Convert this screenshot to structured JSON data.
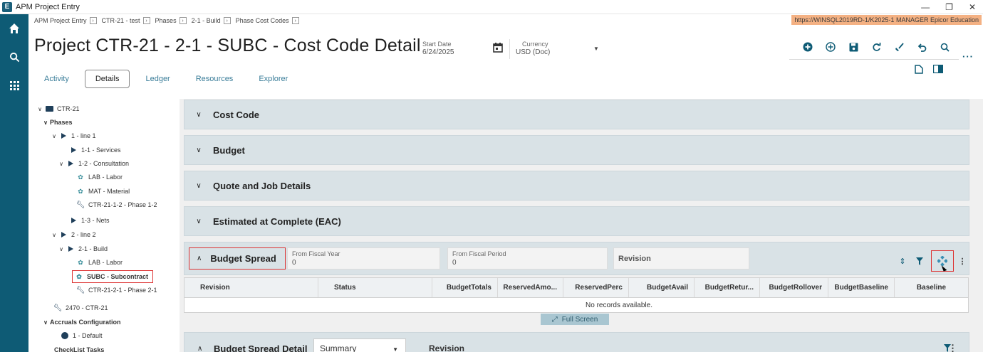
{
  "window": {
    "title": "APM Project Entry"
  },
  "breadcrumbs": [
    "APM Project Entry",
    "CTR-21 - test",
    "Phases",
    "2-1 - Build",
    "Phase Cost Codes"
  ],
  "server_info": "https://WINSQL2019RD-1/K2025-1  MANAGER  Epicor Education",
  "header": {
    "title": "Project CTR-21 - 2-1 - SUBC - Cost Code Detail",
    "start_date_label": "Start Date",
    "start_date_value": "6/24/2025",
    "currency_label": "Currency",
    "currency_value": "USD (Doc)"
  },
  "toolbar_icons": [
    "add-circle-icon",
    "add-outline-icon",
    "save-icon",
    "refresh-icon",
    "clear-icon",
    "undo-icon",
    "search-icon"
  ],
  "tabs": [
    {
      "label": "Activity",
      "active": false
    },
    {
      "label": "Details",
      "active": true
    },
    {
      "label": "Ledger",
      "active": false
    },
    {
      "label": "Resources",
      "active": false
    },
    {
      "label": "Explorer",
      "active": false
    }
  ],
  "tree": [
    {
      "label": "CTR-21"
    },
    {
      "label": "Phases"
    },
    {
      "label": "1 - line 1"
    },
    {
      "label": "1-1 - Services"
    },
    {
      "label": "1-2 - Consultation"
    },
    {
      "label": "LAB - Labor"
    },
    {
      "label": "MAT - Material"
    },
    {
      "label": "CTR-21-1-2 - Phase 1-2"
    },
    {
      "label": "1-3 - Nets"
    },
    {
      "label": "2 - line 2"
    },
    {
      "label": "2-1 - Build"
    },
    {
      "label": "LAB - Labor"
    },
    {
      "label": "SUBC - Subcontract"
    },
    {
      "label": "CTR-21-2-1 - Phase 2-1"
    },
    {
      "label": "2470 - CTR-21"
    },
    {
      "label": "Accruals Configuration"
    },
    {
      "label": "1 - Default"
    },
    {
      "label": "CheckList Tasks"
    }
  ],
  "sections": [
    {
      "title": "Cost Code"
    },
    {
      "title": "Budget"
    },
    {
      "title": "Quote and Job Details"
    },
    {
      "title": "Estimated at Complete (EAC)"
    }
  ],
  "budget_spread": {
    "title": "Budget Spread",
    "from_fiscal_year_label": "From Fiscal Year",
    "from_fiscal_year_value": "0",
    "from_fiscal_period_label": "From Fiscal Period",
    "from_fiscal_period_value": "0",
    "revision_label": "Revision",
    "columns": [
      "Revision",
      "Status",
      "BudgetTotals",
      "ReservedAmo...",
      "ReservedPerc",
      "BudgetAvail",
      "BudgetRetur...",
      "BudgetRollover",
      "BudgetBaseline",
      "Baseline"
    ],
    "empty_text": "No records available.",
    "full_screen_label": "Full Screen"
  },
  "budget_spread_detail": {
    "title": "Budget Spread Detail",
    "view_value": "Summary",
    "revision_label": "Revision"
  }
}
